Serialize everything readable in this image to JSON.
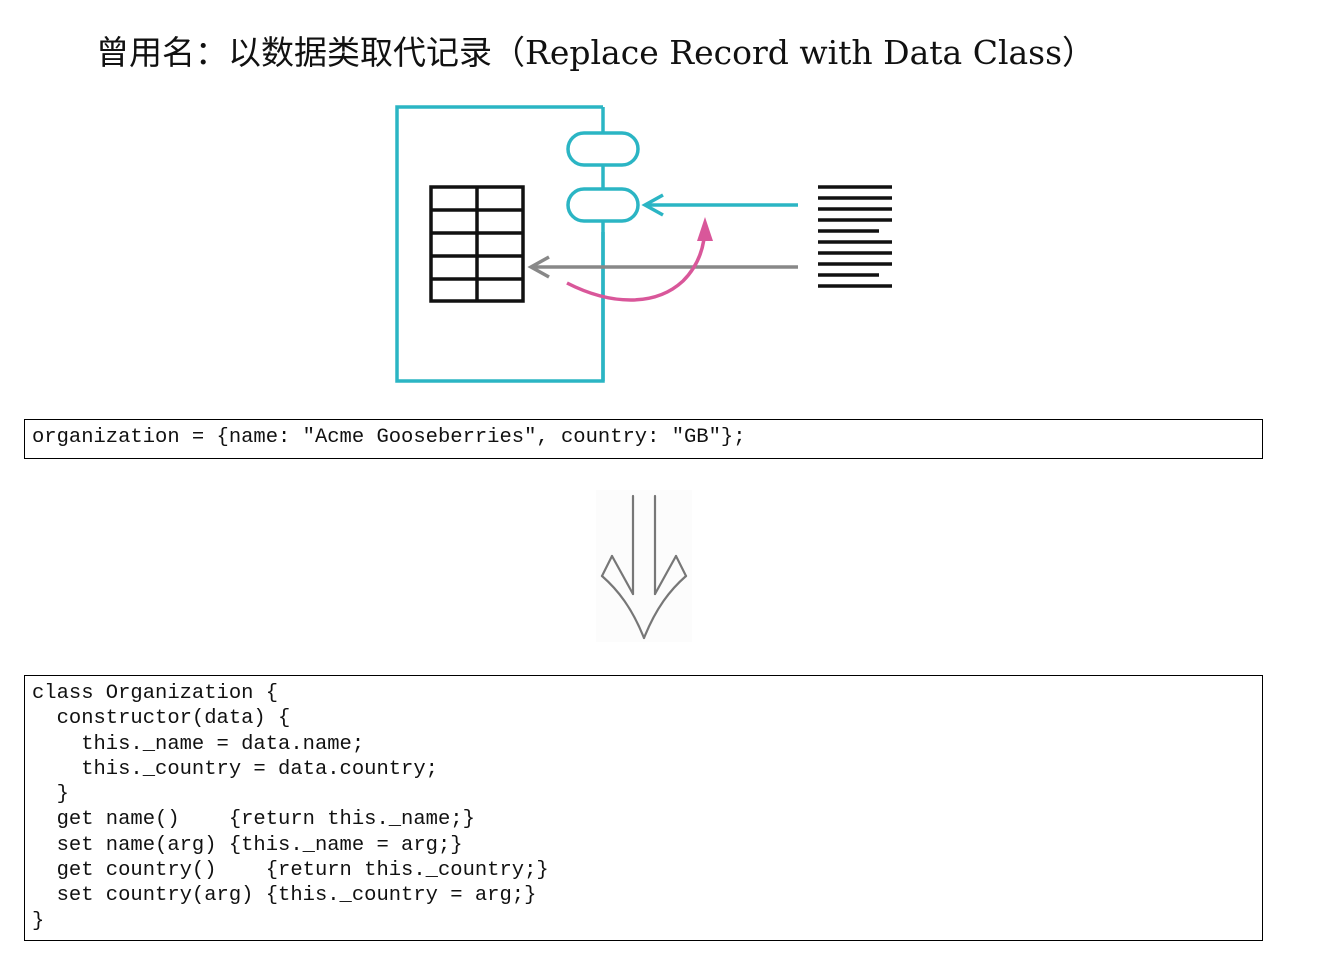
{
  "title": "曾用名：以数据类取代记录（Replace Record with Data Class）",
  "colors": {
    "teal": "#2bb5c4",
    "magenta": "#d9579a",
    "gray": "#888888",
    "black": "#111111",
    "arrow_gray": "#777777"
  },
  "icons": {
    "diagram": "refactoring-illustration",
    "transform": "double-down-arrow-icon"
  },
  "code_before": {
    "lines": [
      "organization = {name: \"Acme Gooseberries\", country: \"GB\"};"
    ]
  },
  "code_after": {
    "lines": [
      "class Organization {",
      "  constructor(data) {",
      "    this._name = data.name;",
      "    this._country = data.country;",
      "  }",
      "  get name()    {return this._name;}",
      "  set name(arg) {this._name = arg;}",
      "  get country()    {return this._country;}",
      "  set country(arg) {this._country = arg;}",
      "}"
    ]
  }
}
